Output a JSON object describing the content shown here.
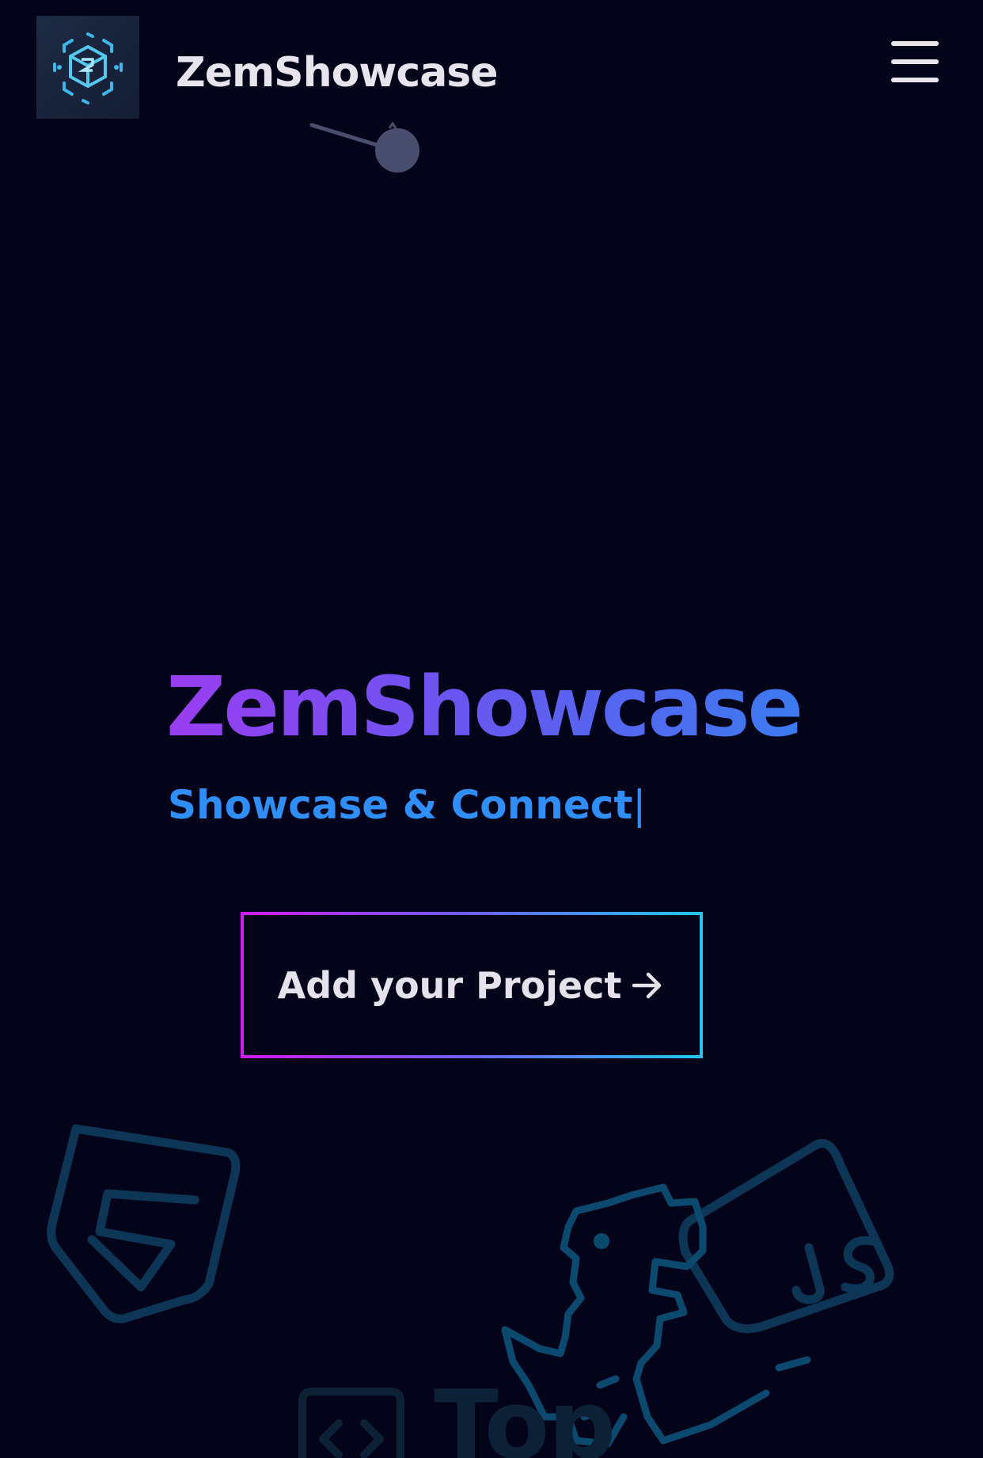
{
  "header": {
    "brand": "ZemShowcase",
    "logo_icon": "cube-logo-icon",
    "menu_icon": "hamburger-menu-icon"
  },
  "hero": {
    "title": "ZemShowcase",
    "subtitle": "Showcase & Connect",
    "cursor": "|",
    "cta_label": "Add your Project",
    "cta_icon": "arrow-right-icon"
  },
  "doodles": {
    "html_icon": "html5-icon",
    "js_icon": "javascript-icon",
    "dino_icon": "dinosaur-icon",
    "code_icon": "code-brackets-icon",
    "partial_text": "Top"
  },
  "colors": {
    "background": "#03041a",
    "title_gradient_start": "#9a3ef2",
    "title_gradient_end": "#3b7bf0",
    "subtitle": "#2f8ef7",
    "cta_border_start": "#d11cf2",
    "cta_border_end": "#21c7ef",
    "doodle": "#0e3a5a"
  }
}
